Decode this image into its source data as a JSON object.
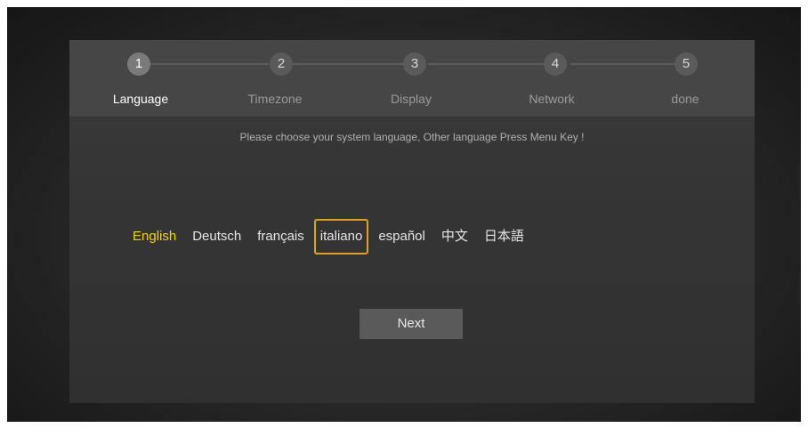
{
  "steps": [
    {
      "number": "1",
      "label": "Language"
    },
    {
      "number": "2",
      "label": "Timezone"
    },
    {
      "number": "3",
      "label": "Display"
    },
    {
      "number": "4",
      "label": "Network"
    },
    {
      "number": "5",
      "label": "done"
    }
  ],
  "current_step": 1,
  "prompt": "Please choose your system language, Other language Press Menu Key !",
  "languages": [
    "English",
    "Deutsch",
    "français",
    "italiano",
    "español",
    "中文",
    "日本語"
  ],
  "selected_language": "English",
  "focused_language": "italiano",
  "next_label": "Next",
  "colors": {
    "selected_text": "#f2d21a",
    "focus_border": "#e0a21a"
  }
}
